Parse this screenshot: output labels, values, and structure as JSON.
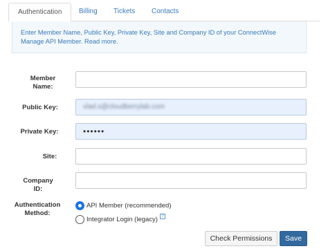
{
  "tabs": [
    {
      "label": "Authentication",
      "active": true
    },
    {
      "label": "Billing",
      "active": false
    },
    {
      "label": "Tickets",
      "active": false
    },
    {
      "label": "Contacts",
      "active": false
    }
  ],
  "info": {
    "text": "Enter Member Name, Public Key, Private Key, Site and Company ID of your ConnectWise Manage API Member.",
    "link": "Read more."
  },
  "form": {
    "member_name": {
      "label_line1": "Member",
      "label_line2": "Name:",
      "value": ""
    },
    "public_key": {
      "label": "Public Key:",
      "value": "vlad.s@cloudberrylab.com"
    },
    "private_key": {
      "label": "Private Key:",
      "value": "••••••"
    },
    "site": {
      "label": "Site:",
      "value": ""
    },
    "company_id": {
      "label": "Company ID:",
      "value": ""
    },
    "auth_method": {
      "label_line1": "Authentication",
      "label_line2": "Method:",
      "options": [
        {
          "label": "API Member (recommended)",
          "selected": true
        },
        {
          "label": "Integrator Login (legacy)",
          "selected": false
        }
      ],
      "help_symbol": "?"
    }
  },
  "buttons": {
    "check_permissions": "Check Permissions",
    "save": "Save"
  },
  "colors": {
    "accent": "#32699e",
    "link": "#3a79b8",
    "autofill_bg": "#e8f0fe",
    "info_bg": "#f3f8fc"
  }
}
